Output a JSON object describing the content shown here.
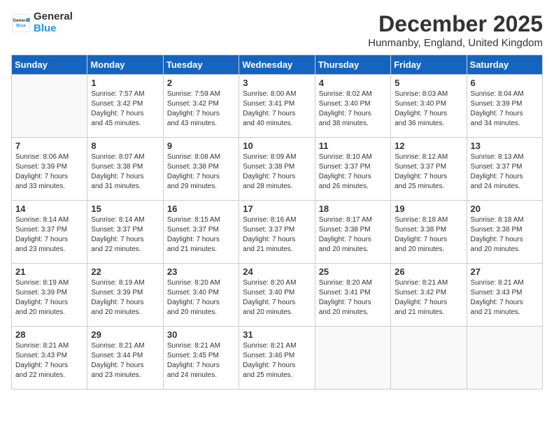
{
  "logo": {
    "general": "General",
    "blue": "Blue"
  },
  "title": "December 2025",
  "location": "Hunmanby, England, United Kingdom",
  "days_of_week": [
    "Sunday",
    "Monday",
    "Tuesday",
    "Wednesday",
    "Thursday",
    "Friday",
    "Saturday"
  ],
  "weeks": [
    [
      {
        "day": "",
        "info": ""
      },
      {
        "day": "1",
        "info": "Sunrise: 7:57 AM\nSunset: 3:42 PM\nDaylight: 7 hours\nand 45 minutes."
      },
      {
        "day": "2",
        "info": "Sunrise: 7:59 AM\nSunset: 3:42 PM\nDaylight: 7 hours\nand 43 minutes."
      },
      {
        "day": "3",
        "info": "Sunrise: 8:00 AM\nSunset: 3:41 PM\nDaylight: 7 hours\nand 40 minutes."
      },
      {
        "day": "4",
        "info": "Sunrise: 8:02 AM\nSunset: 3:40 PM\nDaylight: 7 hours\nand 38 minutes."
      },
      {
        "day": "5",
        "info": "Sunrise: 8:03 AM\nSunset: 3:40 PM\nDaylight: 7 hours\nand 36 minutes."
      },
      {
        "day": "6",
        "info": "Sunrise: 8:04 AM\nSunset: 3:39 PM\nDaylight: 7 hours\nand 34 minutes."
      }
    ],
    [
      {
        "day": "7",
        "info": "Sunrise: 8:06 AM\nSunset: 3:39 PM\nDaylight: 7 hours\nand 33 minutes."
      },
      {
        "day": "8",
        "info": "Sunrise: 8:07 AM\nSunset: 3:38 PM\nDaylight: 7 hours\nand 31 minutes."
      },
      {
        "day": "9",
        "info": "Sunrise: 8:08 AM\nSunset: 3:38 PM\nDaylight: 7 hours\nand 29 minutes."
      },
      {
        "day": "10",
        "info": "Sunrise: 8:09 AM\nSunset: 3:38 PM\nDaylight: 7 hours\nand 28 minutes."
      },
      {
        "day": "11",
        "info": "Sunrise: 8:10 AM\nSunset: 3:37 PM\nDaylight: 7 hours\nand 26 minutes."
      },
      {
        "day": "12",
        "info": "Sunrise: 8:12 AM\nSunset: 3:37 PM\nDaylight: 7 hours\nand 25 minutes."
      },
      {
        "day": "13",
        "info": "Sunrise: 8:13 AM\nSunset: 3:37 PM\nDaylight: 7 hours\nand 24 minutes."
      }
    ],
    [
      {
        "day": "14",
        "info": "Sunrise: 8:14 AM\nSunset: 3:37 PM\nDaylight: 7 hours\nand 23 minutes."
      },
      {
        "day": "15",
        "info": "Sunrise: 8:14 AM\nSunset: 3:37 PM\nDaylight: 7 hours\nand 22 minutes."
      },
      {
        "day": "16",
        "info": "Sunrise: 8:15 AM\nSunset: 3:37 PM\nDaylight: 7 hours\nand 21 minutes."
      },
      {
        "day": "17",
        "info": "Sunrise: 8:16 AM\nSunset: 3:37 PM\nDaylight: 7 hours\nand 21 minutes."
      },
      {
        "day": "18",
        "info": "Sunrise: 8:17 AM\nSunset: 3:38 PM\nDaylight: 7 hours\nand 20 minutes."
      },
      {
        "day": "19",
        "info": "Sunrise: 8:18 AM\nSunset: 3:38 PM\nDaylight: 7 hours\nand 20 minutes."
      },
      {
        "day": "20",
        "info": "Sunrise: 8:18 AM\nSunset: 3:38 PM\nDaylight: 7 hours\nand 20 minutes."
      }
    ],
    [
      {
        "day": "21",
        "info": "Sunrise: 8:19 AM\nSunset: 3:39 PM\nDaylight: 7 hours\nand 20 minutes."
      },
      {
        "day": "22",
        "info": "Sunrise: 8:19 AM\nSunset: 3:39 PM\nDaylight: 7 hours\nand 20 minutes."
      },
      {
        "day": "23",
        "info": "Sunrise: 8:20 AM\nSunset: 3:40 PM\nDaylight: 7 hours\nand 20 minutes."
      },
      {
        "day": "24",
        "info": "Sunrise: 8:20 AM\nSunset: 3:40 PM\nDaylight: 7 hours\nand 20 minutes."
      },
      {
        "day": "25",
        "info": "Sunrise: 8:20 AM\nSunset: 3:41 PM\nDaylight: 7 hours\nand 20 minutes."
      },
      {
        "day": "26",
        "info": "Sunrise: 8:21 AM\nSunset: 3:42 PM\nDaylight: 7 hours\nand 21 minutes."
      },
      {
        "day": "27",
        "info": "Sunrise: 8:21 AM\nSunset: 3:43 PM\nDaylight: 7 hours\nand 21 minutes."
      }
    ],
    [
      {
        "day": "28",
        "info": "Sunrise: 8:21 AM\nSunset: 3:43 PM\nDaylight: 7 hours\nand 22 minutes."
      },
      {
        "day": "29",
        "info": "Sunrise: 8:21 AM\nSunset: 3:44 PM\nDaylight: 7 hours\nand 23 minutes."
      },
      {
        "day": "30",
        "info": "Sunrise: 8:21 AM\nSunset: 3:45 PM\nDaylight: 7 hours\nand 24 minutes."
      },
      {
        "day": "31",
        "info": "Sunrise: 8:21 AM\nSunset: 3:46 PM\nDaylight: 7 hours\nand 25 minutes."
      },
      {
        "day": "",
        "info": ""
      },
      {
        "day": "",
        "info": ""
      },
      {
        "day": "",
        "info": ""
      }
    ]
  ]
}
